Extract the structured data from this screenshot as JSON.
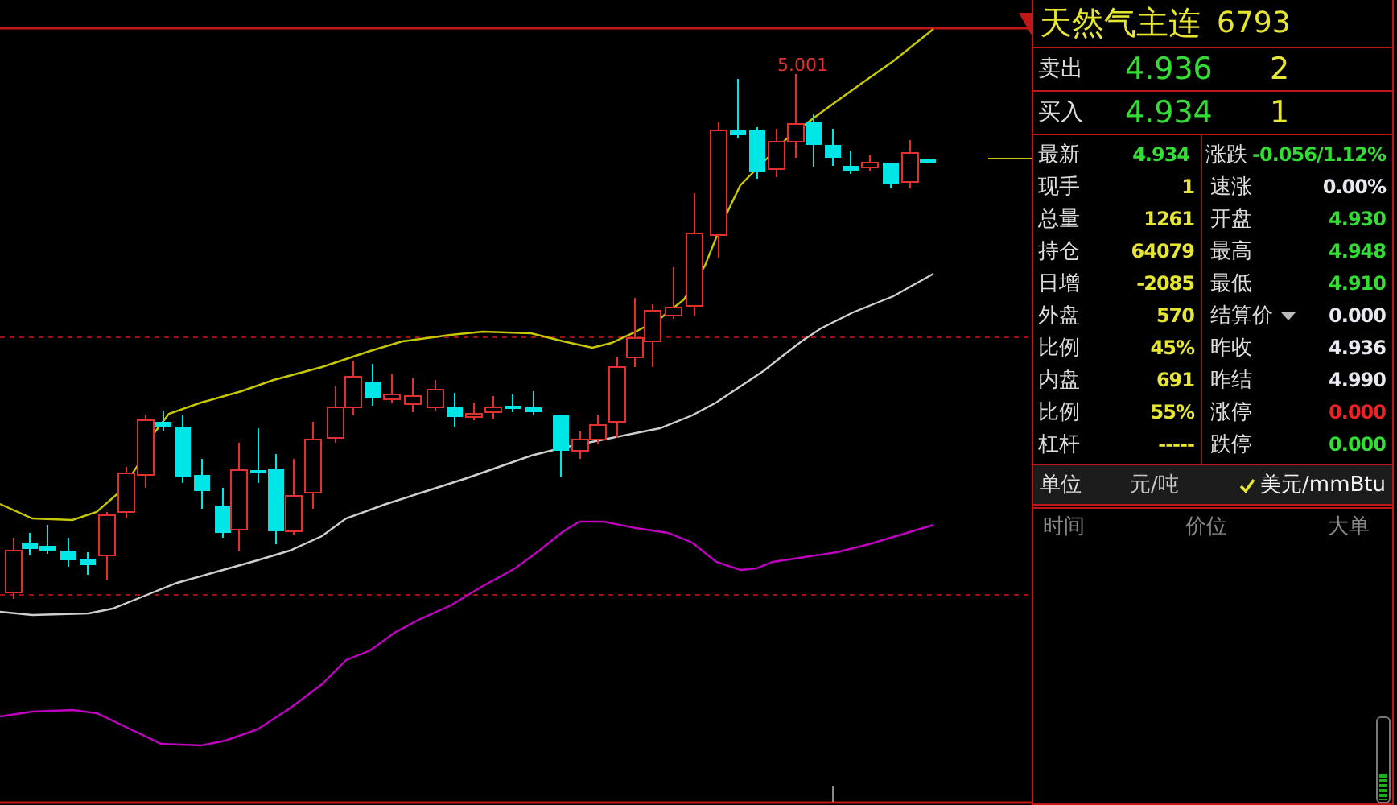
{
  "chart": {
    "high_label": "5.001"
  },
  "quote": {
    "name": "天然气主连",
    "code": "6793"
  },
  "orders": [
    {
      "label": "卖出",
      "price": "4.936",
      "volume": "2"
    },
    {
      "label": "买入",
      "price": "4.934",
      "volume": "1"
    }
  ],
  "stats": [
    {
      "left": {
        "label": "最新",
        "value": "4.934",
        "color": "#33dd33"
      },
      "right": {
        "label": "涨跌",
        "value": "-0.056/1.12%",
        "color": "#33dd33",
        "dropdown": false
      }
    },
    {
      "left": {
        "label": "现手",
        "value": "1",
        "color": "#e6e633"
      },
      "right": {
        "label": "速涨",
        "value": "0.00%",
        "color": "#e8e8f0",
        "dropdown": false
      }
    },
    {
      "left": {
        "label": "总量",
        "value": "1261",
        "color": "#e6e633"
      },
      "right": {
        "label": "开盘",
        "value": "4.930",
        "color": "#33dd33",
        "dropdown": false
      }
    },
    {
      "left": {
        "label": "持仓",
        "value": "64079",
        "color": "#e6e633"
      },
      "right": {
        "label": "最高",
        "value": "4.948",
        "color": "#33dd33",
        "dropdown": false
      }
    },
    {
      "left": {
        "label": "日增",
        "value": "-2085",
        "color": "#e6e633"
      },
      "right": {
        "label": "最低",
        "value": "4.910",
        "color": "#33dd33",
        "dropdown": false
      }
    },
    {
      "left": {
        "label": "外盘",
        "value": "570",
        "color": "#e6e633"
      },
      "right": {
        "label": "结算价",
        "value": "0.000",
        "color": "#e8e8f0",
        "dropdown": true
      }
    },
    {
      "left": {
        "label": "比例",
        "value": "45%",
        "color": "#e6e633"
      },
      "right": {
        "label": "昨收",
        "value": "4.936",
        "color": "#e8e8f0",
        "dropdown": false
      }
    },
    {
      "left": {
        "label": "内盘",
        "value": "691",
        "color": "#e6e633"
      },
      "right": {
        "label": "昨结",
        "value": "4.990",
        "color": "#e8e8f0",
        "dropdown": false
      }
    },
    {
      "left": {
        "label": "比例",
        "value": "55%",
        "color": "#e6e633"
      },
      "right": {
        "label": "涨停",
        "value": "0.000",
        "color": "#ee2222",
        "dropdown": false
      }
    },
    {
      "left": {
        "label": "杠杆",
        "value": "-----",
        "color": "#e6e633"
      },
      "right": {
        "label": "跌停",
        "value": "0.000",
        "color": "#33dd33",
        "dropdown": false
      }
    }
  ],
  "unit": {
    "label": "单位",
    "options": [
      {
        "label": "元/吨",
        "selected": false
      },
      {
        "label": "美元/mmBtu",
        "selected": true
      }
    ]
  },
  "trades": {
    "columns": [
      "时间",
      "价位",
      "大单"
    ]
  }
}
